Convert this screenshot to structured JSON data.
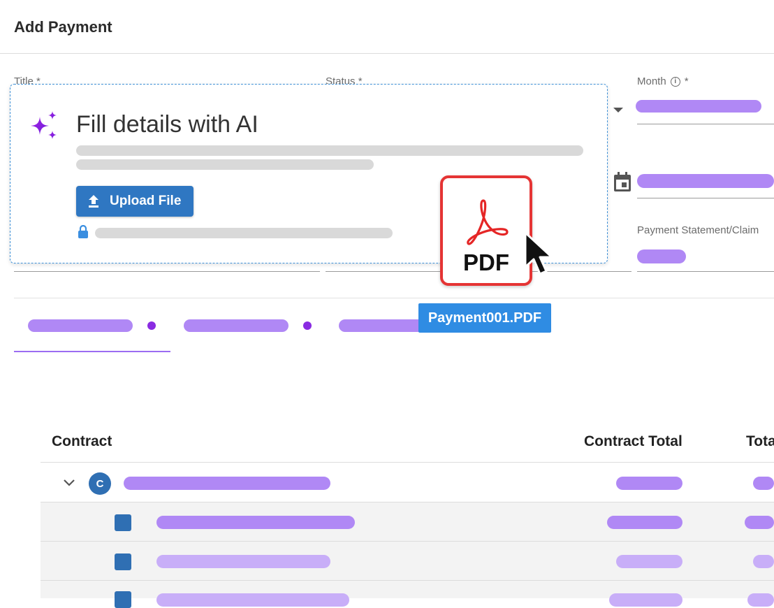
{
  "header": {
    "title": "Add Payment"
  },
  "form": {
    "title_label": "Title *",
    "status_label": "Status *",
    "month_label": "Month",
    "month_required": "*",
    "statement_label": "Payment Statement/Claim"
  },
  "ai_card": {
    "title": "Fill details with AI",
    "upload_label": "Upload File"
  },
  "pdf": {
    "label": "PDF",
    "filename": "Payment001.PDF"
  },
  "table": {
    "columns": [
      "Contract",
      "Contract Total",
      "Tota"
    ],
    "group_avatar": "C"
  },
  "colors": {
    "accent_purple": "#b088f5",
    "primary_blue": "#2f77c2",
    "pdf_red": "#e53434"
  }
}
